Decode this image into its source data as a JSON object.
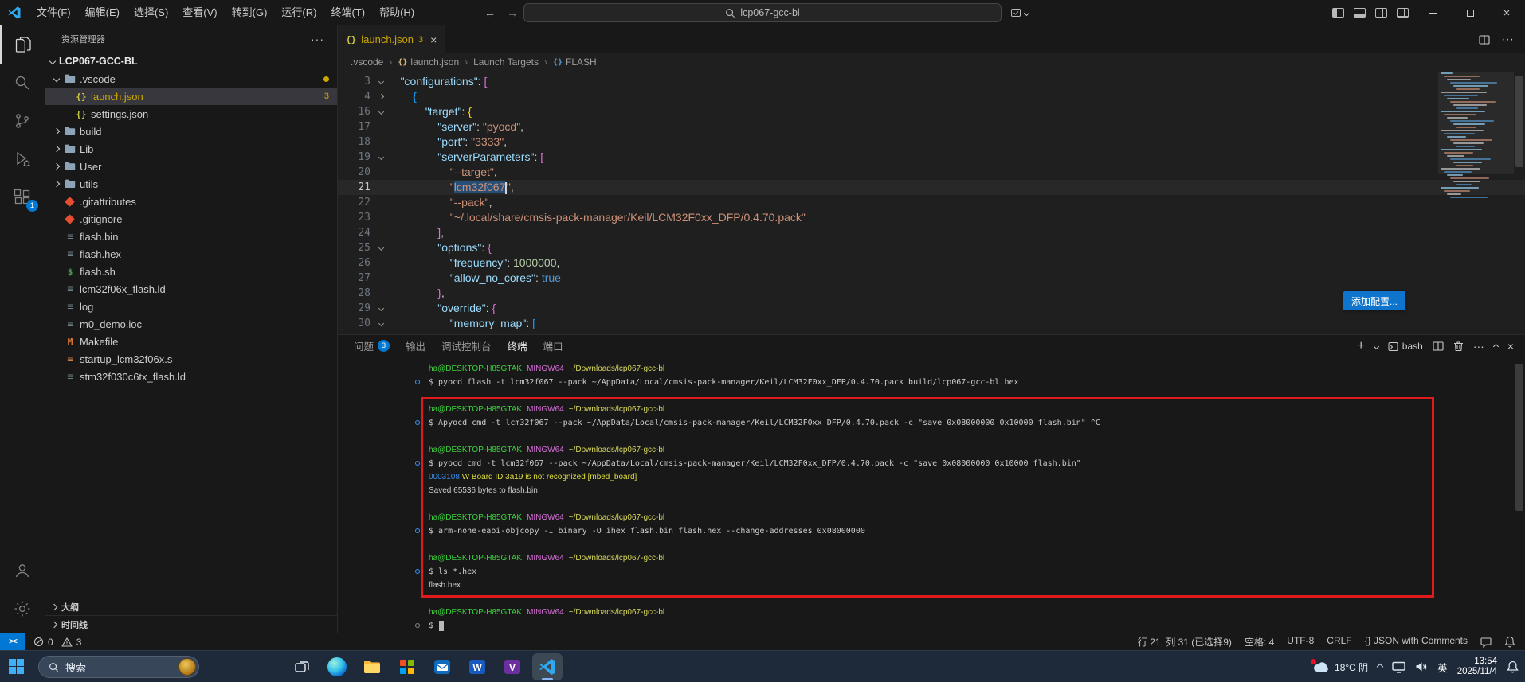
{
  "colors": {
    "accent": "#0078d4",
    "selection": "#264f78",
    "warning": "#cca700",
    "annotation_red": "#e01b1b"
  },
  "titlebar": {
    "menus": [
      {
        "key": "file",
        "label": "文件(F)"
      },
      {
        "key": "edit",
        "label": "编辑(E)"
      },
      {
        "key": "selection",
        "label": "选择(S)"
      },
      {
        "key": "view",
        "label": "查看(V)"
      },
      {
        "key": "goto",
        "label": "转到(G)"
      },
      {
        "key": "run",
        "label": "运行(R)"
      },
      {
        "key": "terminal",
        "label": "终端(T)"
      },
      {
        "key": "help",
        "label": "帮助(H)"
      }
    ],
    "search_value": "lcp067-gcc-bl"
  },
  "activity_bar": {
    "extensions_badge": "1"
  },
  "sidebar": {
    "title": "资源管理器",
    "more_label": "···",
    "root": "LCP067-GCC-BL",
    "items": [
      {
        "label": ".vscode",
        "icon": "folder",
        "indent": 0,
        "chevron": "down",
        "dot": true
      },
      {
        "label": "launch.json",
        "icon": "json",
        "indent": 1,
        "selected": true,
        "badge": "3",
        "warn": true
      },
      {
        "label": "settings.json",
        "icon": "json",
        "indent": 1
      },
      {
        "label": "build",
        "icon": "folder",
        "indent": 0,
        "chevron": "right"
      },
      {
        "label": "Lib",
        "icon": "folder",
        "indent": 0,
        "chevron": "right"
      },
      {
        "label": "User",
        "icon": "folder",
        "indent": 0,
        "chevron": "right"
      },
      {
        "label": "utils",
        "icon": "folder",
        "indent": 0,
        "chevron": "right"
      },
      {
        "label": ".gitattributes",
        "icon": "git",
        "indent": 0
      },
      {
        "label": ".gitignore",
        "icon": "git",
        "indent": 0
      },
      {
        "label": "flash.bin",
        "icon": "file",
        "indent": 0
      },
      {
        "label": "flash.hex",
        "icon": "file",
        "indent": 0
      },
      {
        "label": "flash.sh",
        "icon": "shell",
        "indent": 0
      },
      {
        "label": "lcm32f06x_flash.ld",
        "icon": "file",
        "indent": 0
      },
      {
        "label": "log",
        "icon": "file",
        "indent": 0
      },
      {
        "label": "m0_demo.ioc",
        "icon": "file",
        "indent": 0
      },
      {
        "label": "Makefile",
        "icon": "makefile",
        "indent": 0
      },
      {
        "label": "startup_lcm32f06x.s",
        "icon": "asm",
        "indent": 0
      },
      {
        "label": "stm32f030c6tx_flash.ld",
        "icon": "file",
        "indent": 0
      }
    ],
    "sections": [
      {
        "key": "outline",
        "label": "大纲"
      },
      {
        "key": "timeline",
        "label": "时间线"
      }
    ]
  },
  "editor": {
    "tab": {
      "icon": "{}",
      "label": "launch.json",
      "badge": "3",
      "close": "×"
    },
    "breadcrumb": [
      {
        "label": ".vscode"
      },
      {
        "label": "launch.json",
        "icon": "{}",
        "icon_class": "gold"
      },
      {
        "label": "Launch Targets"
      },
      {
        "label": "FLASH",
        "icon": "{}",
        "icon_class": "blue"
      }
    ],
    "add_config_label": "添加配置...",
    "code_lines": [
      {
        "n": 3,
        "indent": 4,
        "fold": "down",
        "tokens": [
          [
            "\"configurations\"",
            "prop"
          ],
          [
            ": ",
            "p"
          ],
          [
            "[",
            "bpink"
          ]
        ]
      },
      {
        "n": 4,
        "indent": 8,
        "fold": "right",
        "tokens": [
          [
            "{",
            "bblue"
          ]
        ]
      },
      {
        "n": 16,
        "indent": 12,
        "fold": "down",
        "tokens": [
          [
            "\"target\"",
            "prop"
          ],
          [
            ": ",
            "p"
          ],
          [
            "{",
            "bgold"
          ]
        ]
      },
      {
        "n": 17,
        "indent": 16,
        "tokens": [
          [
            "\"server\"",
            "prop"
          ],
          [
            ": ",
            "p"
          ],
          [
            "\"pyocd\"",
            "str"
          ],
          [
            ",",
            "p"
          ]
        ]
      },
      {
        "n": 18,
        "indent": 16,
        "tokens": [
          [
            "\"port\"",
            "prop"
          ],
          [
            ": ",
            "p"
          ],
          [
            "\"3333\"",
            "str"
          ],
          [
            ",",
            "p"
          ]
        ]
      },
      {
        "n": 19,
        "indent": 16,
        "fold": "down",
        "tokens": [
          [
            "\"serverParameters\"",
            "prop"
          ],
          [
            ": ",
            "p"
          ],
          [
            "[",
            "bpink"
          ]
        ]
      },
      {
        "n": 20,
        "indent": 20,
        "tokens": [
          [
            "\"--target\"",
            "str"
          ],
          [
            ",",
            "p"
          ]
        ]
      },
      {
        "n": 21,
        "indent": 20,
        "current": true,
        "tokens": [
          [
            "\"",
            "str"
          ],
          [
            "lcm32f067",
            "str sel"
          ],
          [
            "\"",
            "str"
          ],
          [
            ",",
            "p"
          ]
        ]
      },
      {
        "n": 22,
        "indent": 20,
        "tokens": [
          [
            "\"--pack\"",
            "str"
          ],
          [
            ",",
            "p"
          ]
        ]
      },
      {
        "n": 23,
        "indent": 20,
        "tokens": [
          [
            "\"~/.local/share/cmsis-pack-manager/Keil/LCM32F0xx_DFP/0.4.70.pack\"",
            "str"
          ]
        ]
      },
      {
        "n": 24,
        "indent": 16,
        "tokens": [
          [
            "]",
            "bpink"
          ],
          [
            ",",
            "p"
          ]
        ]
      },
      {
        "n": 25,
        "indent": 16,
        "fold": "down",
        "tokens": [
          [
            "\"options\"",
            "prop"
          ],
          [
            ": ",
            "p"
          ],
          [
            "{",
            "bpink"
          ]
        ]
      },
      {
        "n": 26,
        "indent": 20,
        "tokens": [
          [
            "\"frequency\"",
            "prop"
          ],
          [
            ": ",
            "p"
          ],
          [
            "1000000",
            "num"
          ],
          [
            ",",
            "p"
          ]
        ]
      },
      {
        "n": 27,
        "indent": 20,
        "tokens": [
          [
            "\"allow_no_cores\"",
            "prop"
          ],
          [
            ": ",
            "p"
          ],
          [
            "true",
            "kw"
          ]
        ]
      },
      {
        "n": 28,
        "indent": 16,
        "tokens": [
          [
            "}",
            "bpink"
          ],
          [
            ",",
            "p"
          ]
        ]
      },
      {
        "n": 29,
        "indent": 16,
        "fold": "down",
        "tokens": [
          [
            "\"override\"",
            "prop"
          ],
          [
            ": ",
            "p"
          ],
          [
            "{",
            "bpink"
          ]
        ]
      },
      {
        "n": 30,
        "indent": 20,
        "fold": "down",
        "tokens": [
          [
            "\"memory_map\"",
            "prop"
          ],
          [
            ": ",
            "p"
          ],
          [
            "[",
            "bblue"
          ]
        ]
      }
    ]
  },
  "panel": {
    "tabs": [
      {
        "key": "problems",
        "label": "问题",
        "badge": "3"
      },
      {
        "key": "output",
        "label": "输出"
      },
      {
        "key": "debug-console",
        "label": "调试控制台"
      },
      {
        "key": "terminal",
        "label": "终端",
        "active": true
      },
      {
        "key": "ports",
        "label": "端口"
      }
    ],
    "shell_name": "bash",
    "prompt": {
      "user": "ha@DESKTOP-H85GTAK",
      "env": "MINGW64",
      "path": "~/Downloads/lcp067-gcc-bl"
    },
    "blocks": [
      {
        "command": "pyocd flash -t lcm32f067 --pack ~/AppData/Local/cmsis-pack-manager/Keil/LCM32F0xx_DFP/0.4.70.pack build/lcp067-gcc-bl.hex",
        "output": []
      },
      {
        "command": "Apyocd cmd -t lcm32f067 --pack ~/AppData/Local/cmsis-pack-manager/Keil/LCM32F0xx_DFP/0.4.70.pack -c \"save 0x08000000 0x10000 flash.bin\" ^C",
        "output": []
      },
      {
        "command": "pyocd cmd -t lcm32f067 --pack ~/AppData/Local/cmsis-pack-manager/Keil/LCM32F0xx_DFP/0.4.70.pack -c \"save 0x08000000 0x10000 flash.bin\"",
        "output": [
          [
            [
              "0003108 ",
              "blue"
            ],
            [
              "W Board ID 3a19 is not recognized [mbed_board]",
              "yellow"
            ]
          ],
          [
            [
              "Saved 65536 bytes to flash.bin",
              "fg"
            ]
          ]
        ]
      },
      {
        "command": "arm-none-eabi-objcopy -I binary -O ihex flash.bin flash.hex --change-addresses 0x08000000",
        "output": []
      },
      {
        "command": "ls *.hex",
        "output": [
          [
            [
              "flash.hex",
              "fg"
            ]
          ]
        ]
      },
      {
        "command": "",
        "cursor": true,
        "output": []
      }
    ]
  },
  "statusbar": {
    "remote": "><",
    "errors": "0",
    "warnings": "3",
    "items": [
      {
        "key": "cursor-position",
        "label": "行 21, 列 31 (已选择9)"
      },
      {
        "key": "indentation",
        "label": "空格: 4"
      },
      {
        "key": "encoding",
        "label": "UTF-8"
      },
      {
        "key": "eol",
        "label": "CRLF"
      },
      {
        "key": "language-mode",
        "label": "{} JSON with Comments"
      }
    ]
  },
  "taskbar": {
    "search_label": "搜索",
    "apps": [
      "task-view",
      "edge",
      "file-explorer",
      "photos",
      "mail",
      "word",
      "v-app",
      "vscode"
    ],
    "weather": "18°C 阴",
    "ime": "英",
    "time": "13:54",
    "date": "2025/11/4"
  }
}
